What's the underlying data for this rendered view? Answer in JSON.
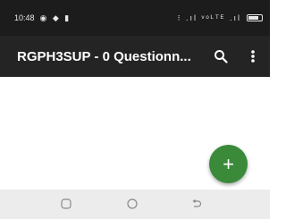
{
  "status_bar": {
    "time": "10:48",
    "left_icons": "◉ ◆ ▮",
    "right_icons": "⁝ .ıl ᵛᵒᴸᵀᴱ .ıl"
  },
  "app_bar": {
    "title": "RGPH3SUP - 0 Questionn...",
    "search_icon": "search-icon",
    "more_icon": "more-vertical-icon"
  },
  "fab": {
    "label": "+"
  },
  "nav_bar": {
    "items": [
      "recents",
      "home",
      "back"
    ]
  }
}
